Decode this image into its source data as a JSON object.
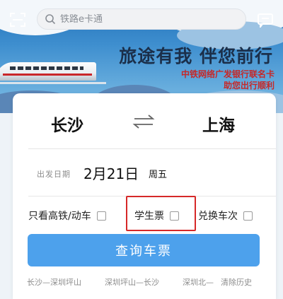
{
  "header": {
    "search_placeholder": "铁路e卡通"
  },
  "banner": {
    "slogan": "旅途有我 伴您前行",
    "line1": "中铁网络广发银行联名卡",
    "line2": "助您出行顺利"
  },
  "ticket_search": {
    "from_station": "长沙",
    "to_station": "上海",
    "date_label": "出发日期",
    "date_value": "2月21日",
    "weekday": "周五",
    "options": {
      "hsr_only": "只看高铁/动车",
      "student": "学生票",
      "exchange": "兑换车次"
    },
    "query_button": "查询车票",
    "history": [
      "长沙—深圳坪山",
      "深圳坪山—长沙",
      "深圳北—"
    ],
    "clear_history": "清除历史"
  },
  "colors": {
    "primary_button": "#4da1ec",
    "highlight_border": "#d62828"
  },
  "icons": {
    "scan": "scan-icon",
    "search": "search-icon",
    "message": "message-icon",
    "swap": "swap-icon"
  }
}
